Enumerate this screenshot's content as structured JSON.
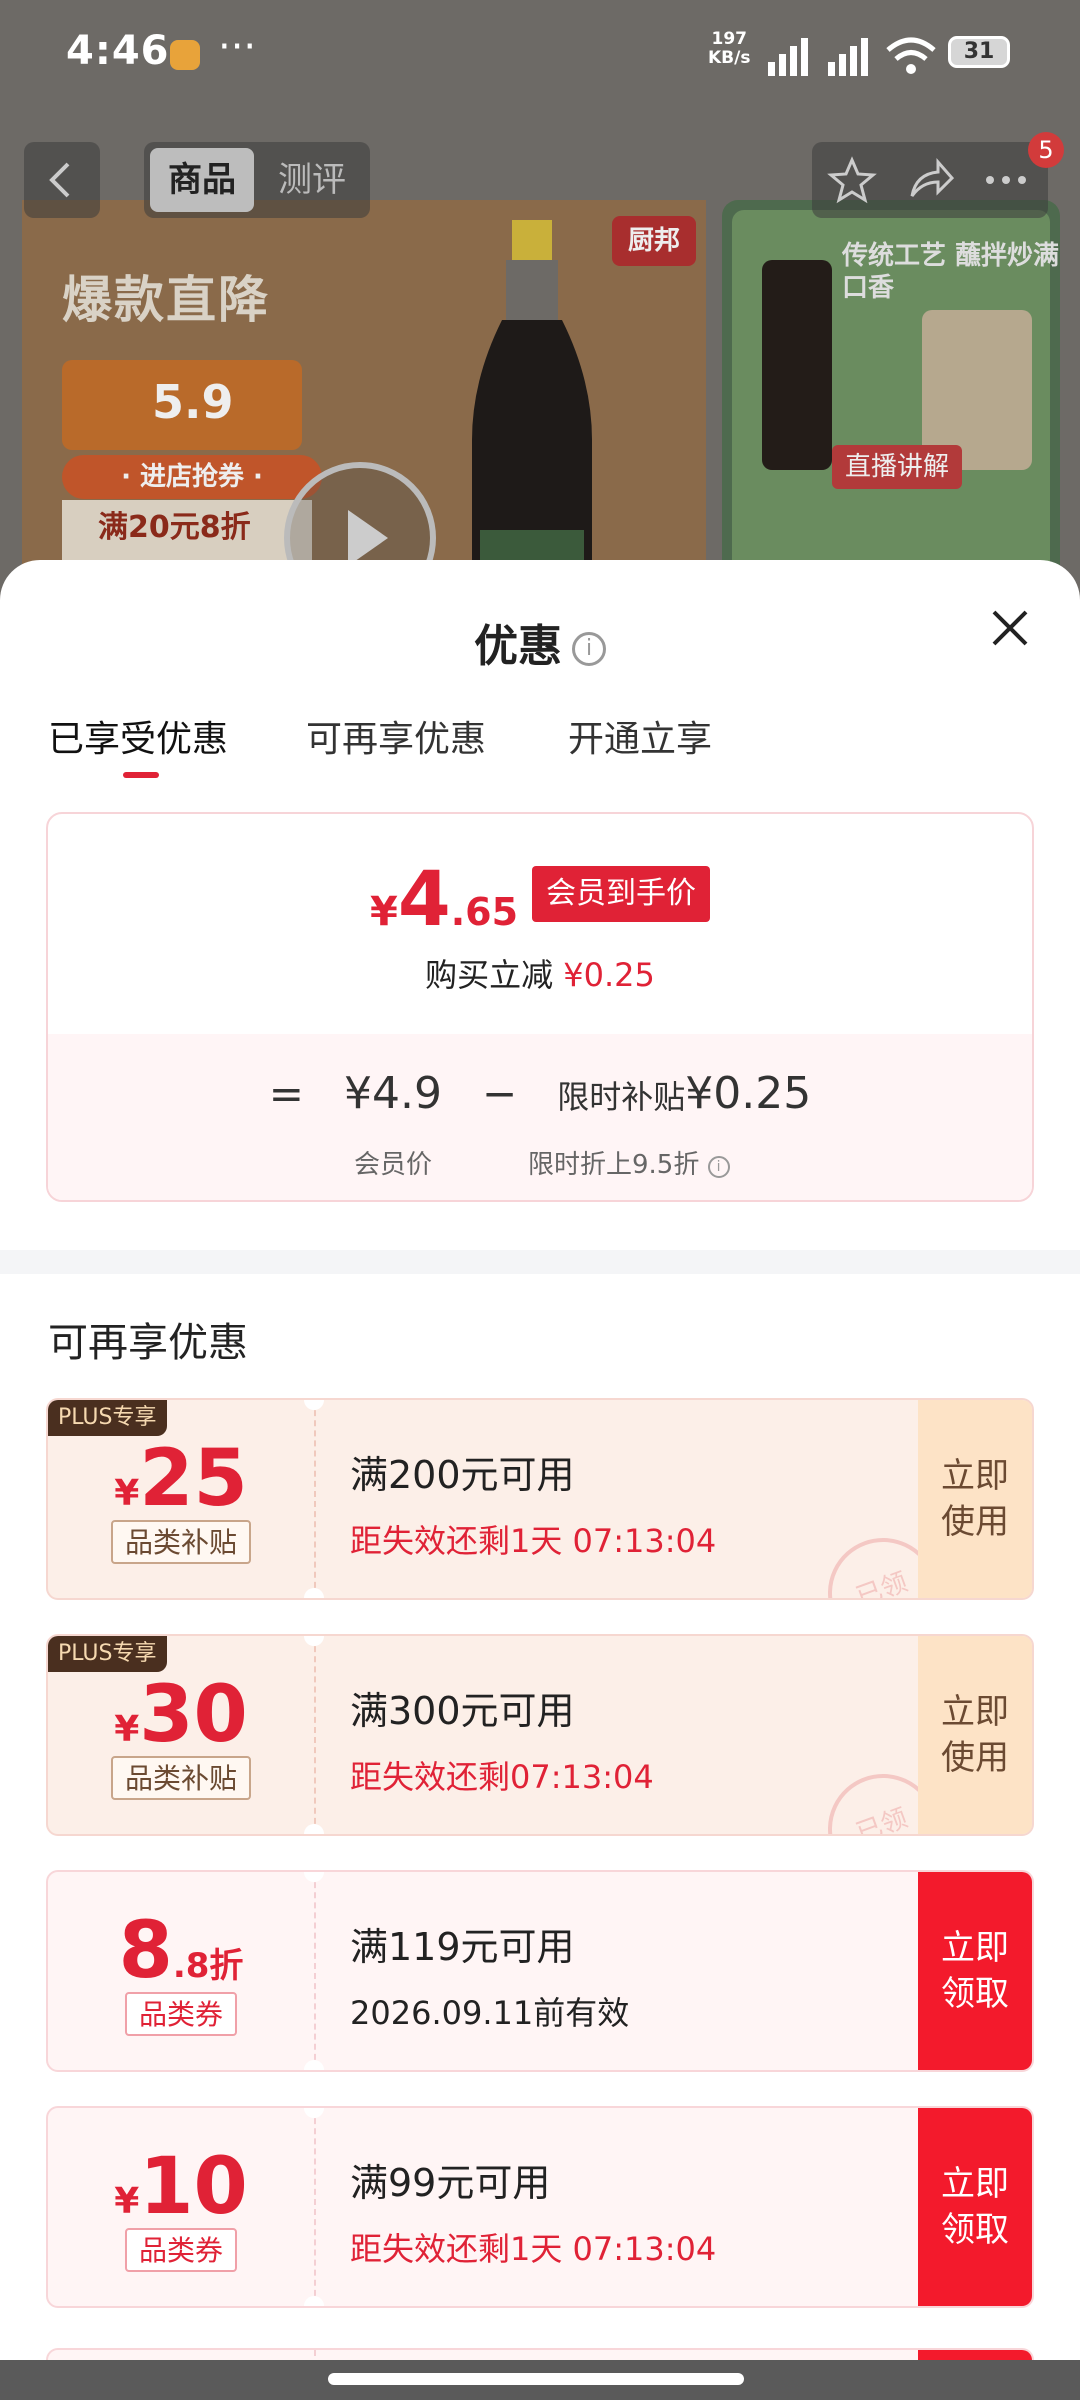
{
  "status": {
    "time": "4:46",
    "dots": "···",
    "speed_value": "197",
    "speed_unit": "KB/s",
    "sig1": "5G",
    "sig2": "4G",
    "battery": "31"
  },
  "nav": {
    "tab_product": "商品",
    "tab_review": "测评",
    "badge": "5"
  },
  "banner": {
    "headline": "爆款直降",
    "price": "5.9",
    "cta": "· 进店抢券 ·",
    "coupon": "满20元8折",
    "brand": "厨邦",
    "right_text": "传统工艺 蘸拌炒满口香",
    "live": "直播讲解"
  },
  "sheet": {
    "title": "优惠",
    "info_icon": "i",
    "tabs": [
      "已享受优惠",
      "可再享优惠",
      "开通立享"
    ],
    "active_tab": 0,
    "price_symbol": "¥",
    "price_int": "4",
    "price_dec": ".65",
    "member_tag": "会员到手价",
    "reduce_label": "购买立减",
    "reduce_amount": "¥0.25",
    "formula_eq": "=",
    "formula_base": "¥4.9",
    "formula_minus": "−",
    "formula_sub_label": "限时补贴",
    "formula_sub_amount": "¥0.25",
    "formula_base_caption": "会员价",
    "formula_sub_caption": "限时折上9.5折",
    "section_title": "可再享优惠"
  },
  "coupons": [
    {
      "type": "plus",
      "badge": "PLUS专享",
      "symbol": "¥",
      "amount": "25",
      "suffix": "",
      "tag": "品类补贴",
      "condition": "满200元可用",
      "expiry": "距失效还剩1天 07:13:04",
      "action": "立即使用",
      "stamp": "已领"
    },
    {
      "type": "plus",
      "badge": "PLUS专享",
      "symbol": "¥",
      "amount": "30",
      "suffix": "",
      "tag": "品类补贴",
      "condition": "满300元可用",
      "expiry": "距失效还剩07:13:04",
      "action": "立即使用",
      "stamp": "已领"
    },
    {
      "type": "cat",
      "badge": "",
      "symbol": "",
      "amount": "8",
      "suffix": ".8折",
      "tag": "品类券",
      "condition": "满119元可用",
      "expiry": "2026.09.11前有效",
      "action": "立即领取",
      "stamp": ""
    },
    {
      "type": "cat",
      "badge": "",
      "symbol": "¥",
      "amount": "10",
      "suffix": "",
      "tag": "品类券",
      "condition": "满99元可用",
      "expiry": "距失效还剩1天 07:13:04",
      "action": "立即领取",
      "stamp": ""
    }
  ],
  "colors": {
    "accent": "#e02236",
    "action_red": "#f31a2c",
    "plus_action": "#fde3c6"
  }
}
